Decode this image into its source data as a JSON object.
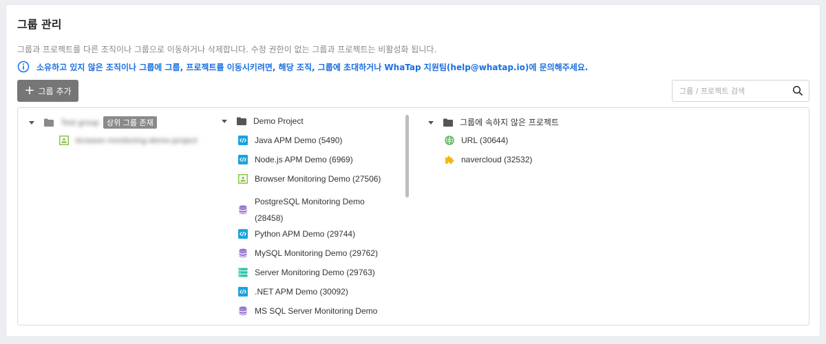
{
  "page": {
    "title": "그룹 관리",
    "description": "그룹과 프로젝트를 다른 조직이나 그룹으로 이동하거나 삭제합니다. 수정 권한이 없는 그룹과 프로젝트는 비활성화 됩니다.",
    "notice": "소유하고 있지 않은 조직이나 그룹에 그룹, 프로젝트를 이동시키려면, 해당 조직, 그룹에 초대하거나 WhaTap 지원팀(help@whatap.io)에 문의해주세요."
  },
  "toolbar": {
    "add_group_label": "그룹 추가",
    "search_placeholder": "그룹 / 프로젝트 검색"
  },
  "tree": {
    "column1": {
      "group_name": "Test group",
      "badge": "상위 그룹 존재",
      "child": "browser-monitoring-demo-project"
    },
    "column2": {
      "group_name": "Demo Project",
      "projects": [
        {
          "label": "Java APM Demo (5490)",
          "icon": "apm-code-icon"
        },
        {
          "label": "Node.js APM Demo (6969)",
          "icon": "apm-code-icon"
        },
        {
          "label": "Browser Monitoring Demo (27506)",
          "icon": "browser-icon"
        },
        {
          "label": "PostgreSQL Monitoring Demo (28458)",
          "icon": "database-icon"
        },
        {
          "label": "Python APM Demo (29744)",
          "icon": "apm-code-icon"
        },
        {
          "label": "MySQL Monitoring Demo (29762)",
          "icon": "database-icon"
        },
        {
          "label": "Server Monitoring Demo (29763)",
          "icon": "server-icon"
        },
        {
          "label": ".NET APM Demo (30092)",
          "icon": "apm-code-icon"
        },
        {
          "label": "MS SQL Server Monitoring Demo",
          "icon": "database-icon"
        }
      ]
    },
    "column3": {
      "group_name": "그룹에 속하지 않은 프로젝트",
      "projects": [
        {
          "label": "URL (30644)",
          "icon": "globe-icon"
        },
        {
          "label": "navercloud (32532)",
          "icon": "puzzle-icon"
        }
      ]
    }
  },
  "colors": {
    "accent_blue": "#1a6fe0",
    "apm_icon": "#1aa3e0",
    "browser_icon": "#8bc34a",
    "database_icon": "#9575cd",
    "server_icon": "#26c6a4",
    "globe_icon": "#4caf50",
    "puzzle_icon": "#f5b800",
    "button_gray": "#767676"
  }
}
